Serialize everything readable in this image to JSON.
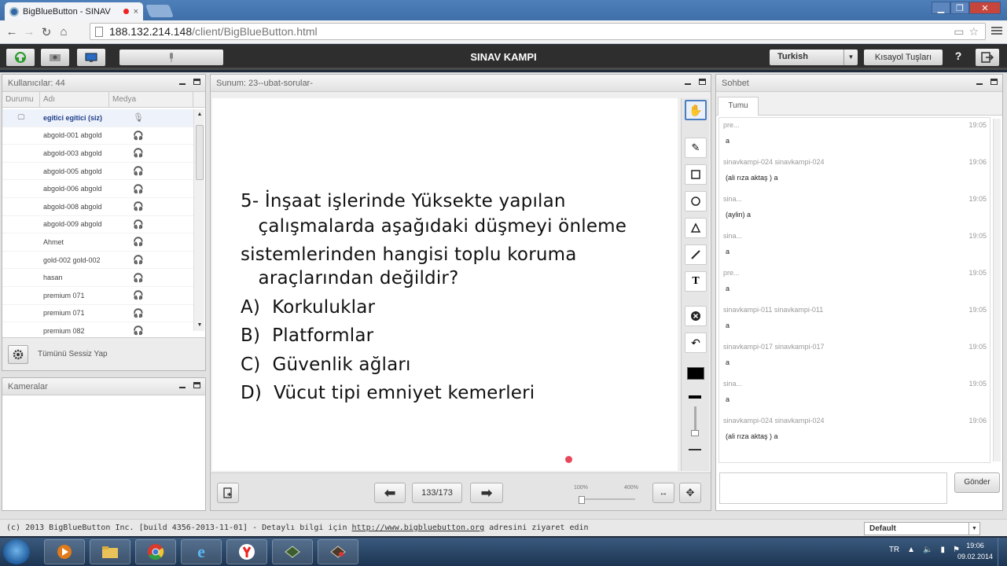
{
  "browser": {
    "tab_title": "BigBlueButton - SINAV",
    "tab_close": "×",
    "url_host": "188.132.214.148",
    "url_path": "/client/BigBlueButton.html"
  },
  "toolbar": {
    "title": "SINAV KAMPI",
    "language": "Turkish",
    "shortcuts_label": "Kısayol Tuşları",
    "help_label": "?"
  },
  "users_panel": {
    "title": "Kullanıcılar: 44",
    "columns": [
      "Durumu",
      "Adı",
      "Medya"
    ],
    "rows": [
      {
        "name": "egitici egitici (siz)",
        "selected": true
      },
      {
        "name": "abgold-001 abgold"
      },
      {
        "name": "abgold-003 abgold"
      },
      {
        "name": "abgold-005 abgold"
      },
      {
        "name": "abgold-006 abgold"
      },
      {
        "name": "abgold-008 abgold"
      },
      {
        "name": "abgold-009 abgold"
      },
      {
        "name": "Ahmet"
      },
      {
        "name": "gold-002 gold-002"
      },
      {
        "name": "hasan"
      },
      {
        "name": "premium 071"
      },
      {
        "name": "premium 071"
      },
      {
        "name": "premium 082"
      }
    ],
    "mute_all_label": "Tümünü Sessiz Yap"
  },
  "cameras_panel": {
    "title": "Kameralar"
  },
  "presentation": {
    "title": "Sunum: 23--ubat-sorular-",
    "question_lines": [
      "5- İnşaat işlerinde Yüksekte yapılan",
      "   çalışmalarda aşağıdaki düşmeyi önleme",
      "sistemlerinden hangisi toplu koruma",
      "   araçlarından değildir?"
    ],
    "options": [
      "A)  Korkuluklar",
      "B)  Platformlar",
      "C)  Güvenlik ağları",
      "D)  Vücut tipi emniyet kemerleri"
    ],
    "page_indicator": "133/173",
    "zoom_min": "100%",
    "zoom_max": "400%"
  },
  "chat": {
    "title": "Sohbet",
    "tab": "Tumu",
    "messages": [
      {
        "who": "pre...",
        "time": "19:05",
        "text": "a"
      },
      {
        "who": "sinavkampi-024 sinavkampi-024",
        "time": "19:06",
        "text": "(ali rıza aktaş ) a"
      },
      {
        "who": "sina...",
        "time": "19:05",
        "text": "(aylin) a"
      },
      {
        "who": "sina...",
        "time": "19:05",
        "text": "a"
      },
      {
        "who": "pre...",
        "time": "19:05",
        "text": "a"
      },
      {
        "who": "sinavkampi-011 sinavkampi-011",
        "time": "19:05",
        "text": "a"
      },
      {
        "who": "sinavkampi-017 sinavkampi-017",
        "time": "19:05",
        "text": "a"
      },
      {
        "who": "sina...",
        "time": "19:05",
        "text": "a"
      },
      {
        "who": "sinavkampi-024 sinavkampi-024",
        "time": "19:06",
        "text": "(ali rıza aktaş ) a"
      }
    ],
    "send_label": "Gönder"
  },
  "footer": {
    "copyright": "(c) 2013 BigBlueButton Inc. [build 4356-2013-11-01] - Detaylı bilgi için",
    "link": "http://www.bigbluebutton.org",
    "suffix": "adresini ziyaret edin",
    "layout": "Default"
  },
  "taskbar": {
    "lang": "TR",
    "time": "19:06",
    "date": "09.02.2014"
  }
}
